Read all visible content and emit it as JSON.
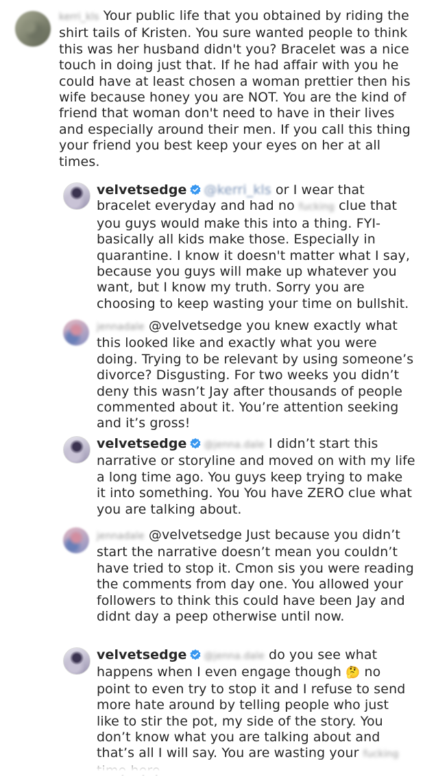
{
  "comments": [
    {
      "username": "kerri_kls",
      "text": "Your public life that you obtained by riding the shirt tails of Kristen. You sure wanted people to think this was her husband didn't you? Bracelet was a nice touch in doing just that. If he had affair with you he could have at least chosen a woman prettier then his wife because honey you are NOT. You are the kind of friend that woman don't need to have in their lives and especially around their men. If you call this thing your friend you best keep your eyes on her at all times."
    },
    {
      "username": "velvetsedge",
      "mention": "@kerri_kls",
      "text_before": "or I wear that bracelet everyday and had no",
      "censored": "fucking",
      "text_after": "clue that you guys would make this into a thing. FYI- basically all kids make those. Especially in quarantine. I know it doesn't matter what I say, because you guys will make up whatever you want, but I know my truth. Sorry you are choosing to keep wasting your time on bullshit."
    },
    {
      "username": "jennadale",
      "text": "@velvetsedge you knew exactly what this looked like and exactly what you were doing. Trying to be relevant by using someone’s divorce? Disgusting. For two weeks you didn’t deny this wasn’t Jay after thousands of people commented about it. You’re attention seeking and it’s gross!"
    },
    {
      "username": "velvetsedge",
      "mention": "@jenna.dale",
      "text": "I didn’t start this narrative or storyline and moved on with my life a long time ago. You guys keep trying to make it into something. You You have ZERO clue what you are talking about."
    },
    {
      "username": "jennadale",
      "text": "@velvetsedge Just because you didn’t start the narrative doesn’t mean you couldn’t have tried to stop it. Cmon sis you were reading the comments from day one. You allowed your followers to think this could have been Jay and didnt day a peep otherwise until now."
    },
    {
      "username": "velvetsedge",
      "mention": "@jenna.dale",
      "text_before": "do you see what happens when I even engage though",
      "emoji": "🤔",
      "text_mid": "no point to even try to stop it and I refuse to send more hate around by telling people who just like to stir the pot, my side of the story. You don’t know what you are talking about and that’s all I will say. You are wasting your",
      "censored": "fucking",
      "text_after": "time here"
    }
  ],
  "icons": {
    "verified": "verified-badge-icon",
    "verified_color": "#3897f0"
  }
}
